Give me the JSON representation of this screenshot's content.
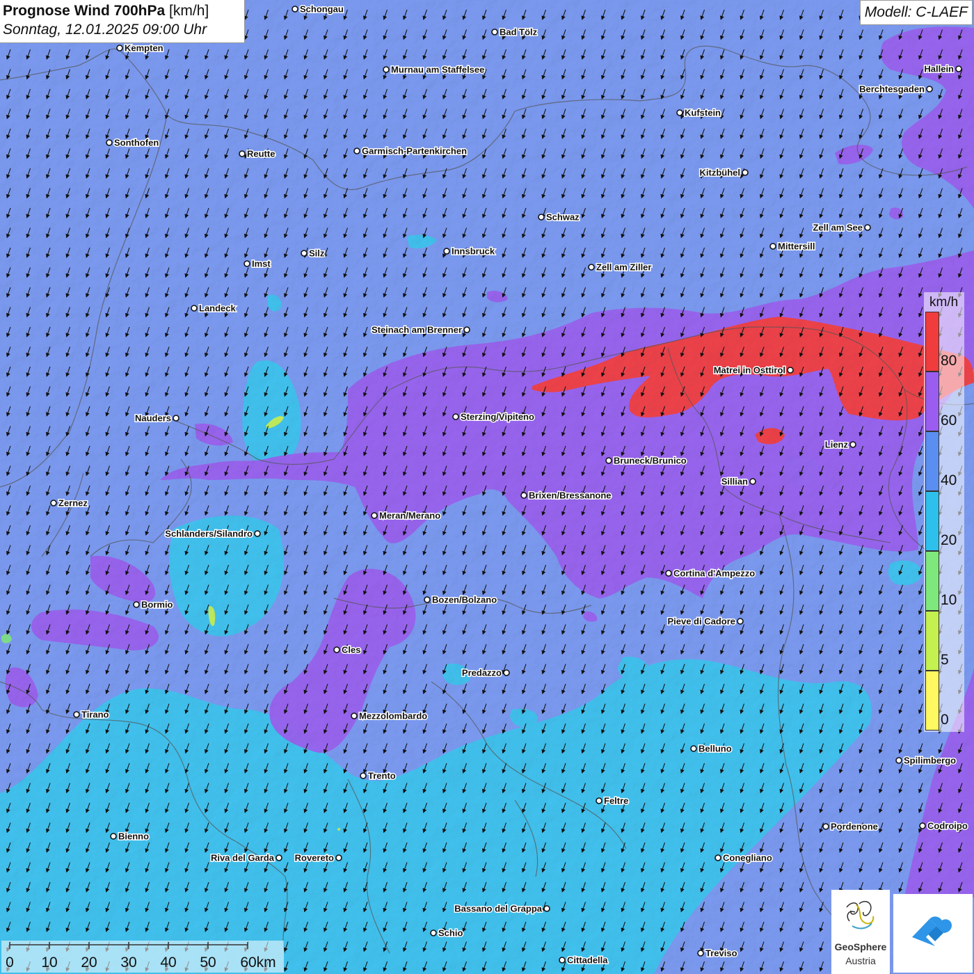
{
  "title": {
    "main": "Prognose Wind 700hPa",
    "unit": "[km/h]",
    "datetime": "Sonntag, 12.01.2025 09:00 Uhr"
  },
  "model": "Modell: C-LAEF",
  "legend": {
    "unit": "km/h",
    "labels": [
      "80",
      "60",
      "40",
      "20",
      "10",
      "5",
      "0"
    ],
    "colors": [
      "#f03c3c",
      "#9b5cf0",
      "#5a8ef0",
      "#2ec0ec",
      "#7ee87c",
      "#c4f050",
      "#fff860"
    ]
  },
  "scale": {
    "labels": [
      "0",
      "10",
      "20",
      "30",
      "40",
      "50",
      "60km"
    ]
  },
  "logo": {
    "name": "GeoSphere",
    "sub": "Austria"
  },
  "cities": [
    {
      "name": "Schongau",
      "side": "r"
    },
    {
      "name": "Bad Tölz",
      "side": "r"
    },
    {
      "name": "Kempten",
      "side": "r"
    },
    {
      "name": "Murnau am Staffelsee",
      "side": "r"
    },
    {
      "name": "Hallein",
      "side": "l"
    },
    {
      "name": "Berchtesgaden",
      "side": "l"
    },
    {
      "name": "Kufstein",
      "side": "r"
    },
    {
      "name": "Sonthofen",
      "side": "r"
    },
    {
      "name": "Reutte",
      "side": "r"
    },
    {
      "name": "Garmisch-Partenkirchen",
      "side": "r"
    },
    {
      "name": "Kitzbühel",
      "side": "l"
    },
    {
      "name": "Schwaz",
      "side": "r"
    },
    {
      "name": "Zell am See",
      "side": "l"
    },
    {
      "name": "Innsbruck",
      "side": "r"
    },
    {
      "name": "Mittersill",
      "side": "r"
    },
    {
      "name": "Silz",
      "side": "r"
    },
    {
      "name": "Imst",
      "side": "r"
    },
    {
      "name": "Zell am Ziller",
      "side": "r"
    },
    {
      "name": "Landeck",
      "side": "r"
    },
    {
      "name": "Steinach am Brenner",
      "side": "l"
    },
    {
      "name": "Matrei in Osttirol",
      "side": "l"
    },
    {
      "name": "Nauders",
      "side": "l"
    },
    {
      "name": "Sterzing/Vipiteno",
      "side": "r"
    },
    {
      "name": "Lienz",
      "side": "l"
    },
    {
      "name": "Bruneck/Brunico",
      "side": "r"
    },
    {
      "name": "Sillian",
      "side": "l"
    },
    {
      "name": "Zernez",
      "side": "r"
    },
    {
      "name": "Brixen/Bressanone",
      "side": "r"
    },
    {
      "name": "Meran/Merano",
      "side": "r"
    },
    {
      "name": "Schlanders/Silandro",
      "side": "l"
    },
    {
      "name": "Cortina d'Ampezzo",
      "side": "r"
    },
    {
      "name": "Bozen/Bolzano",
      "side": "r"
    },
    {
      "name": "Bormio",
      "side": "r"
    },
    {
      "name": "Pieve di Cadore",
      "side": "l"
    },
    {
      "name": "Cles",
      "side": "r"
    },
    {
      "name": "Predazzo",
      "side": "l"
    },
    {
      "name": "Tirano",
      "side": "r"
    },
    {
      "name": "Mezzolombardo",
      "side": "r"
    },
    {
      "name": "Belluno",
      "side": "r"
    },
    {
      "name": "Spilimbergo",
      "side": "r"
    },
    {
      "name": "Trento",
      "side": "r"
    },
    {
      "name": "Feltre",
      "side": "r"
    },
    {
      "name": "Pordenone",
      "side": "r"
    },
    {
      "name": "Codroipo",
      "side": "r"
    },
    {
      "name": "Bienno",
      "side": "r"
    },
    {
      "name": "Riva del Garda",
      "side": "l"
    },
    {
      "name": "Rovereto",
      "side": "l"
    },
    {
      "name": "Conegliano",
      "side": "r"
    },
    {
      "name": "Bassano del Grappa",
      "side": "l"
    },
    {
      "name": "Schio",
      "side": "r"
    },
    {
      "name": "Treviso",
      "side": "r"
    },
    {
      "name": "Cittadella",
      "side": "r"
    }
  ]
}
